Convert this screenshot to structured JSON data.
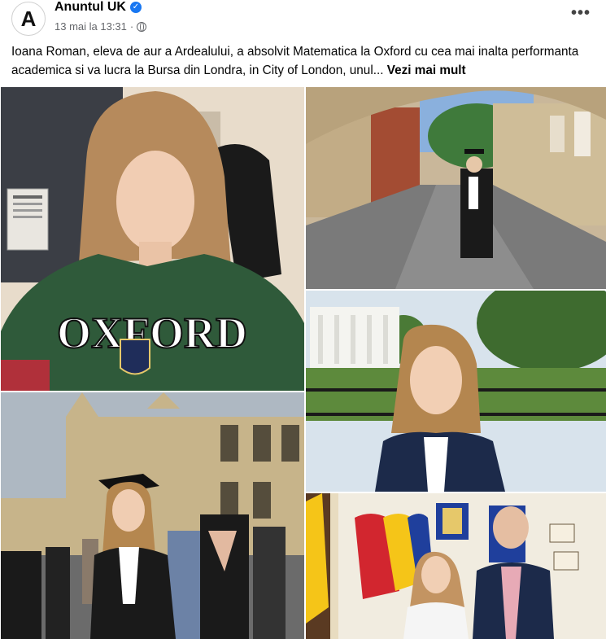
{
  "post": {
    "page_name": "Anuntul UK",
    "avatar_letter": "A",
    "timestamp": "13 mai la 13:31",
    "separator": "·",
    "verified_icon": "verified-badge-icon",
    "privacy_icon": "globe-icon",
    "more_label": "•••",
    "text": "Ioana Roman, eleva de aur a Ardealului, a absolvit Matematica la Oxford cu cea mai inalta performanta academica si va lucra la Bursa din Londra, in City of London, unul...",
    "see_more": "Vezi mai mult"
  },
  "photos": {
    "sweatshirt_text": "OXFORD",
    "colors": {
      "accent": "#1877f2",
      "sweatshirt_green": "#2f5a3a",
      "gown_black": "#1a1a1a",
      "flag_blue": "#1f3f9c",
      "flag_yellow": "#f5c518",
      "flag_red": "#d2262f"
    }
  }
}
